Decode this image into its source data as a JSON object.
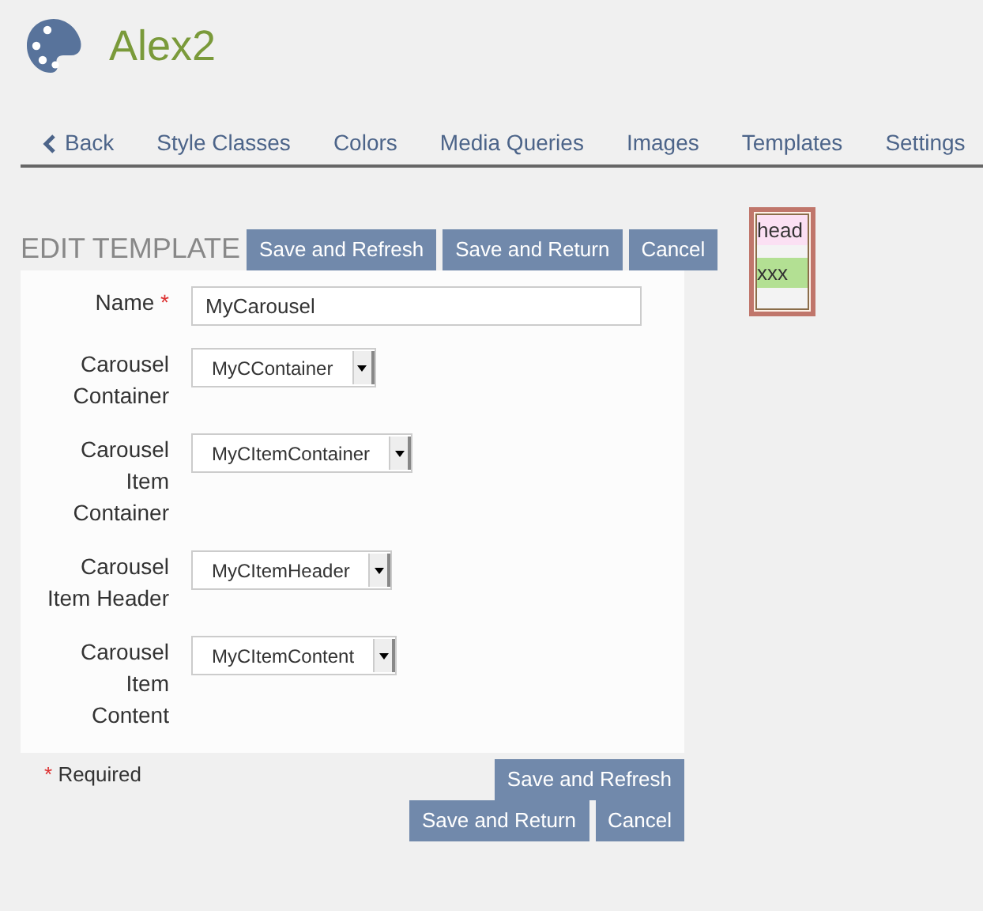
{
  "header": {
    "title": "Alex2"
  },
  "nav": [
    {
      "label": "Back",
      "kind": "back"
    },
    {
      "label": "Style Classes",
      "kind": "link"
    },
    {
      "label": "Colors",
      "kind": "link"
    },
    {
      "label": "Media Queries",
      "kind": "link"
    },
    {
      "label": "Images",
      "kind": "link"
    },
    {
      "label": "Templates",
      "kind": "link"
    },
    {
      "label": "Settings",
      "kind": "link"
    }
  ],
  "form": {
    "heading": "EDIT TEMPLATE",
    "top_buttons": [
      "Save and Refresh",
      "Save and Return",
      "Cancel"
    ],
    "fields": [
      {
        "label": "Name",
        "required": true,
        "kind": "text",
        "value": "MyCarousel"
      },
      {
        "label": "Carousel Container",
        "required": false,
        "kind": "select",
        "value": "MyCContainer"
      },
      {
        "label": "Carousel Item Container",
        "required": false,
        "kind": "select",
        "value": "MyCItemContainer"
      },
      {
        "label": "Carousel Item Header",
        "required": false,
        "kind": "select",
        "value": "MyCItemHeader"
      },
      {
        "label": "Carousel Item Content",
        "required": false,
        "kind": "select",
        "value": "MyCItemContent"
      }
    ],
    "required_mark": "*",
    "required_note": "Required",
    "bottom_buttons": [
      "Save and Refresh",
      "Save and Return",
      "Cancel"
    ]
  },
  "preview": {
    "rows": [
      {
        "text": "head",
        "color": "#fbe0f3"
      },
      {
        "text": "xxx",
        "color": "#b3e093"
      }
    ]
  }
}
